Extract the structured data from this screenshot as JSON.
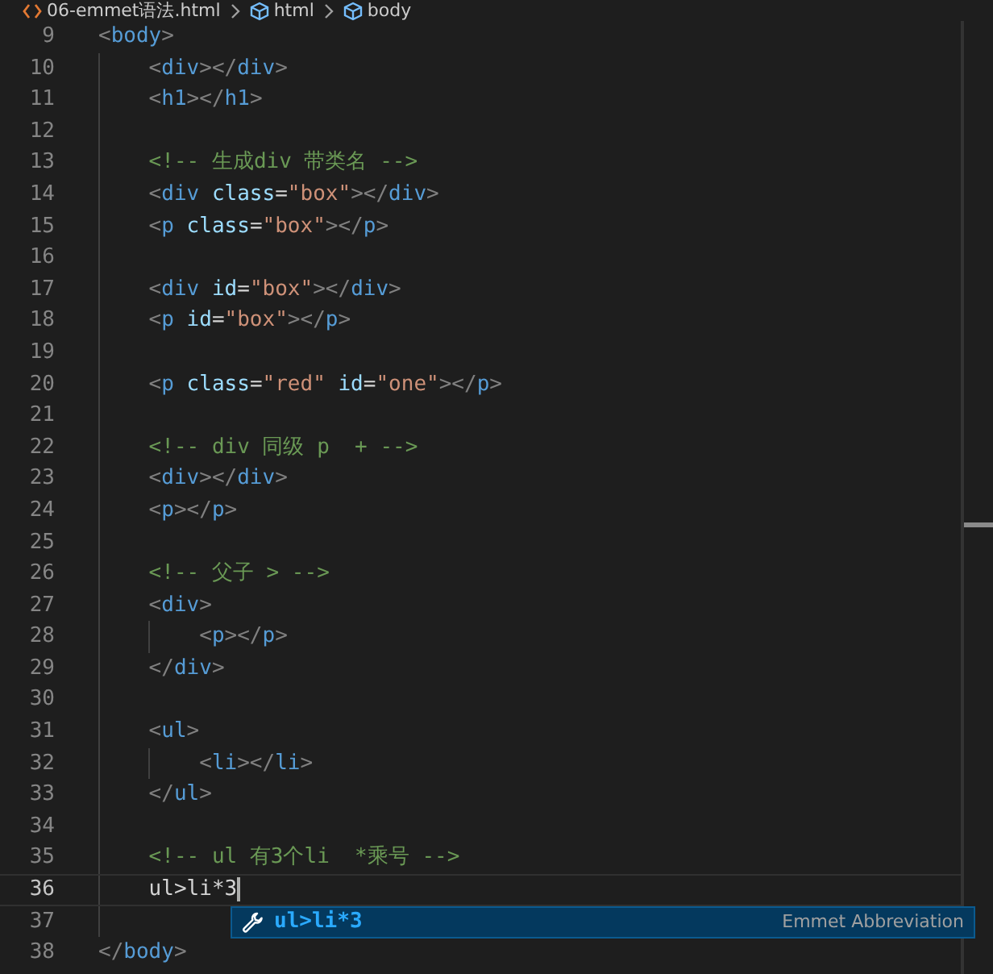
{
  "breadcrumb": [
    {
      "kind": "file",
      "label": "06-emmet语法.html"
    },
    {
      "kind": "symbol",
      "label": "html"
    },
    {
      "kind": "symbol",
      "label": "body"
    }
  ],
  "lines": [
    {
      "number": "9",
      "current": false,
      "tokens": [
        {
          "kind": "punct",
          "text": "<"
        },
        {
          "kind": "tag",
          "text": "body"
        },
        {
          "kind": "punct",
          "text": ">"
        }
      ]
    },
    {
      "number": "10",
      "current": false,
      "tokens": [
        {
          "kind": "punct",
          "text": "    <"
        },
        {
          "kind": "tag",
          "text": "div"
        },
        {
          "kind": "punct",
          "text": "></"
        },
        {
          "kind": "tag",
          "text": "div"
        },
        {
          "kind": "punct",
          "text": ">"
        }
      ]
    },
    {
      "number": "11",
      "current": false,
      "tokens": [
        {
          "kind": "punct",
          "text": "    <"
        },
        {
          "kind": "tag",
          "text": "h1"
        },
        {
          "kind": "punct",
          "text": "></"
        },
        {
          "kind": "tag",
          "text": "h1"
        },
        {
          "kind": "punct",
          "text": ">"
        }
      ]
    },
    {
      "number": "12",
      "current": false
    },
    {
      "number": "13",
      "current": false,
      "tokens": [
        {
          "kind": "comment",
          "text": "    <!-- 生成div 带类名 -->"
        }
      ]
    },
    {
      "number": "14",
      "current": false,
      "tokens": [
        {
          "kind": "punct",
          "text": "    <"
        },
        {
          "kind": "tag",
          "text": "div"
        },
        {
          "kind": "attr",
          "text": " class"
        },
        {
          "kind": "text",
          "text": "="
        },
        {
          "kind": "string",
          "text": "\"box\""
        },
        {
          "kind": "punct",
          "text": "></"
        },
        {
          "kind": "tag",
          "text": "div"
        },
        {
          "kind": "punct",
          "text": ">"
        }
      ]
    },
    {
      "number": "15",
      "current": false,
      "tokens": [
        {
          "kind": "punct",
          "text": "    <"
        },
        {
          "kind": "tag",
          "text": "p"
        },
        {
          "kind": "attr",
          "text": " class"
        },
        {
          "kind": "text",
          "text": "="
        },
        {
          "kind": "string",
          "text": "\"box\""
        },
        {
          "kind": "punct",
          "text": "></"
        },
        {
          "kind": "tag",
          "text": "p"
        },
        {
          "kind": "punct",
          "text": ">"
        }
      ]
    },
    {
      "number": "16",
      "current": false
    },
    {
      "number": "17",
      "current": false,
      "tokens": [
        {
          "kind": "punct",
          "text": "    <"
        },
        {
          "kind": "tag",
          "text": "div"
        },
        {
          "kind": "attr",
          "text": " id"
        },
        {
          "kind": "text",
          "text": "="
        },
        {
          "kind": "string",
          "text": "\"box\""
        },
        {
          "kind": "punct",
          "text": "></"
        },
        {
          "kind": "tag",
          "text": "div"
        },
        {
          "kind": "punct",
          "text": ">"
        }
      ]
    },
    {
      "number": "18",
      "current": false,
      "tokens": [
        {
          "kind": "punct",
          "text": "    <"
        },
        {
          "kind": "tag",
          "text": "p"
        },
        {
          "kind": "attr",
          "text": " id"
        },
        {
          "kind": "text",
          "text": "="
        },
        {
          "kind": "string",
          "text": "\"box\""
        },
        {
          "kind": "punct",
          "text": "></"
        },
        {
          "kind": "tag",
          "text": "p"
        },
        {
          "kind": "punct",
          "text": ">"
        }
      ]
    },
    {
      "number": "19",
      "current": false
    },
    {
      "number": "20",
      "current": false,
      "tokens": [
        {
          "kind": "punct",
          "text": "    <"
        },
        {
          "kind": "tag",
          "text": "p"
        },
        {
          "kind": "attr",
          "text": " class"
        },
        {
          "kind": "text",
          "text": "="
        },
        {
          "kind": "string",
          "text": "\"red\""
        },
        {
          "kind": "attr",
          "text": " id"
        },
        {
          "kind": "text",
          "text": "="
        },
        {
          "kind": "string",
          "text": "\"one\""
        },
        {
          "kind": "punct",
          "text": "></"
        },
        {
          "kind": "tag",
          "text": "p"
        },
        {
          "kind": "punct",
          "text": ">"
        }
      ]
    },
    {
      "number": "21",
      "current": false
    },
    {
      "number": "22",
      "current": false,
      "tokens": [
        {
          "kind": "comment",
          "text": "    <!-- div 同级 p  + -->"
        }
      ]
    },
    {
      "number": "23",
      "current": false,
      "tokens": [
        {
          "kind": "punct",
          "text": "    <"
        },
        {
          "kind": "tag",
          "text": "div"
        },
        {
          "kind": "punct",
          "text": "></"
        },
        {
          "kind": "tag",
          "text": "div"
        },
        {
          "kind": "punct",
          "text": ">"
        }
      ]
    },
    {
      "number": "24",
      "current": false,
      "tokens": [
        {
          "kind": "punct",
          "text": "    <"
        },
        {
          "kind": "tag",
          "text": "p"
        },
        {
          "kind": "punct",
          "text": "></"
        },
        {
          "kind": "tag",
          "text": "p"
        },
        {
          "kind": "punct",
          "text": ">"
        }
      ]
    },
    {
      "number": "25",
      "current": false
    },
    {
      "number": "26",
      "current": false,
      "tokens": [
        {
          "kind": "comment",
          "text": "    <!-- 父子 > -->"
        }
      ]
    },
    {
      "number": "27",
      "current": false,
      "tokens": [
        {
          "kind": "punct",
          "text": "    <"
        },
        {
          "kind": "tag",
          "text": "div"
        },
        {
          "kind": "punct",
          "text": ">"
        }
      ]
    },
    {
      "number": "28",
      "current": false,
      "tokens": [
        {
          "kind": "punct",
          "text": "        <"
        },
        {
          "kind": "tag",
          "text": "p"
        },
        {
          "kind": "punct",
          "text": "></"
        },
        {
          "kind": "tag",
          "text": "p"
        },
        {
          "kind": "punct",
          "text": ">"
        }
      ]
    },
    {
      "number": "29",
      "current": false,
      "tokens": [
        {
          "kind": "punct",
          "text": "    </"
        },
        {
          "kind": "tag",
          "text": "div"
        },
        {
          "kind": "punct",
          "text": ">"
        }
      ]
    },
    {
      "number": "30",
      "current": false
    },
    {
      "number": "31",
      "current": false,
      "tokens": [
        {
          "kind": "punct",
          "text": "    <"
        },
        {
          "kind": "tag",
          "text": "ul"
        },
        {
          "kind": "punct",
          "text": ">"
        }
      ]
    },
    {
      "number": "32",
      "current": false,
      "tokens": [
        {
          "kind": "punct",
          "text": "        <"
        },
        {
          "kind": "tag",
          "text": "li"
        },
        {
          "kind": "punct",
          "text": "></"
        },
        {
          "kind": "tag",
          "text": "li"
        },
        {
          "kind": "punct",
          "text": ">"
        }
      ]
    },
    {
      "number": "33",
      "current": false,
      "tokens": [
        {
          "kind": "punct",
          "text": "    </"
        },
        {
          "kind": "tag",
          "text": "ul"
        },
        {
          "kind": "punct",
          "text": ">"
        }
      ]
    },
    {
      "number": "34",
      "current": false
    },
    {
      "number": "35",
      "current": false,
      "tokens": [
        {
          "kind": "comment",
          "text": "    <!-- ul 有3个li  *乘号 -->"
        }
      ]
    },
    {
      "number": "36",
      "current": true,
      "tokens": [
        {
          "kind": "text",
          "text": "    ul>li*3"
        }
      ]
    },
    {
      "number": "37",
      "current": false
    },
    {
      "number": "38",
      "current": false,
      "tokens": [
        {
          "kind": "punct",
          "text": "</"
        },
        {
          "kind": "tag",
          "text": "body"
        },
        {
          "kind": "punct",
          "text": ">"
        }
      ]
    }
  ],
  "suggestion": {
    "label": "ul>li*3",
    "detail": "Emmet Abbreviation",
    "selected": true
  }
}
